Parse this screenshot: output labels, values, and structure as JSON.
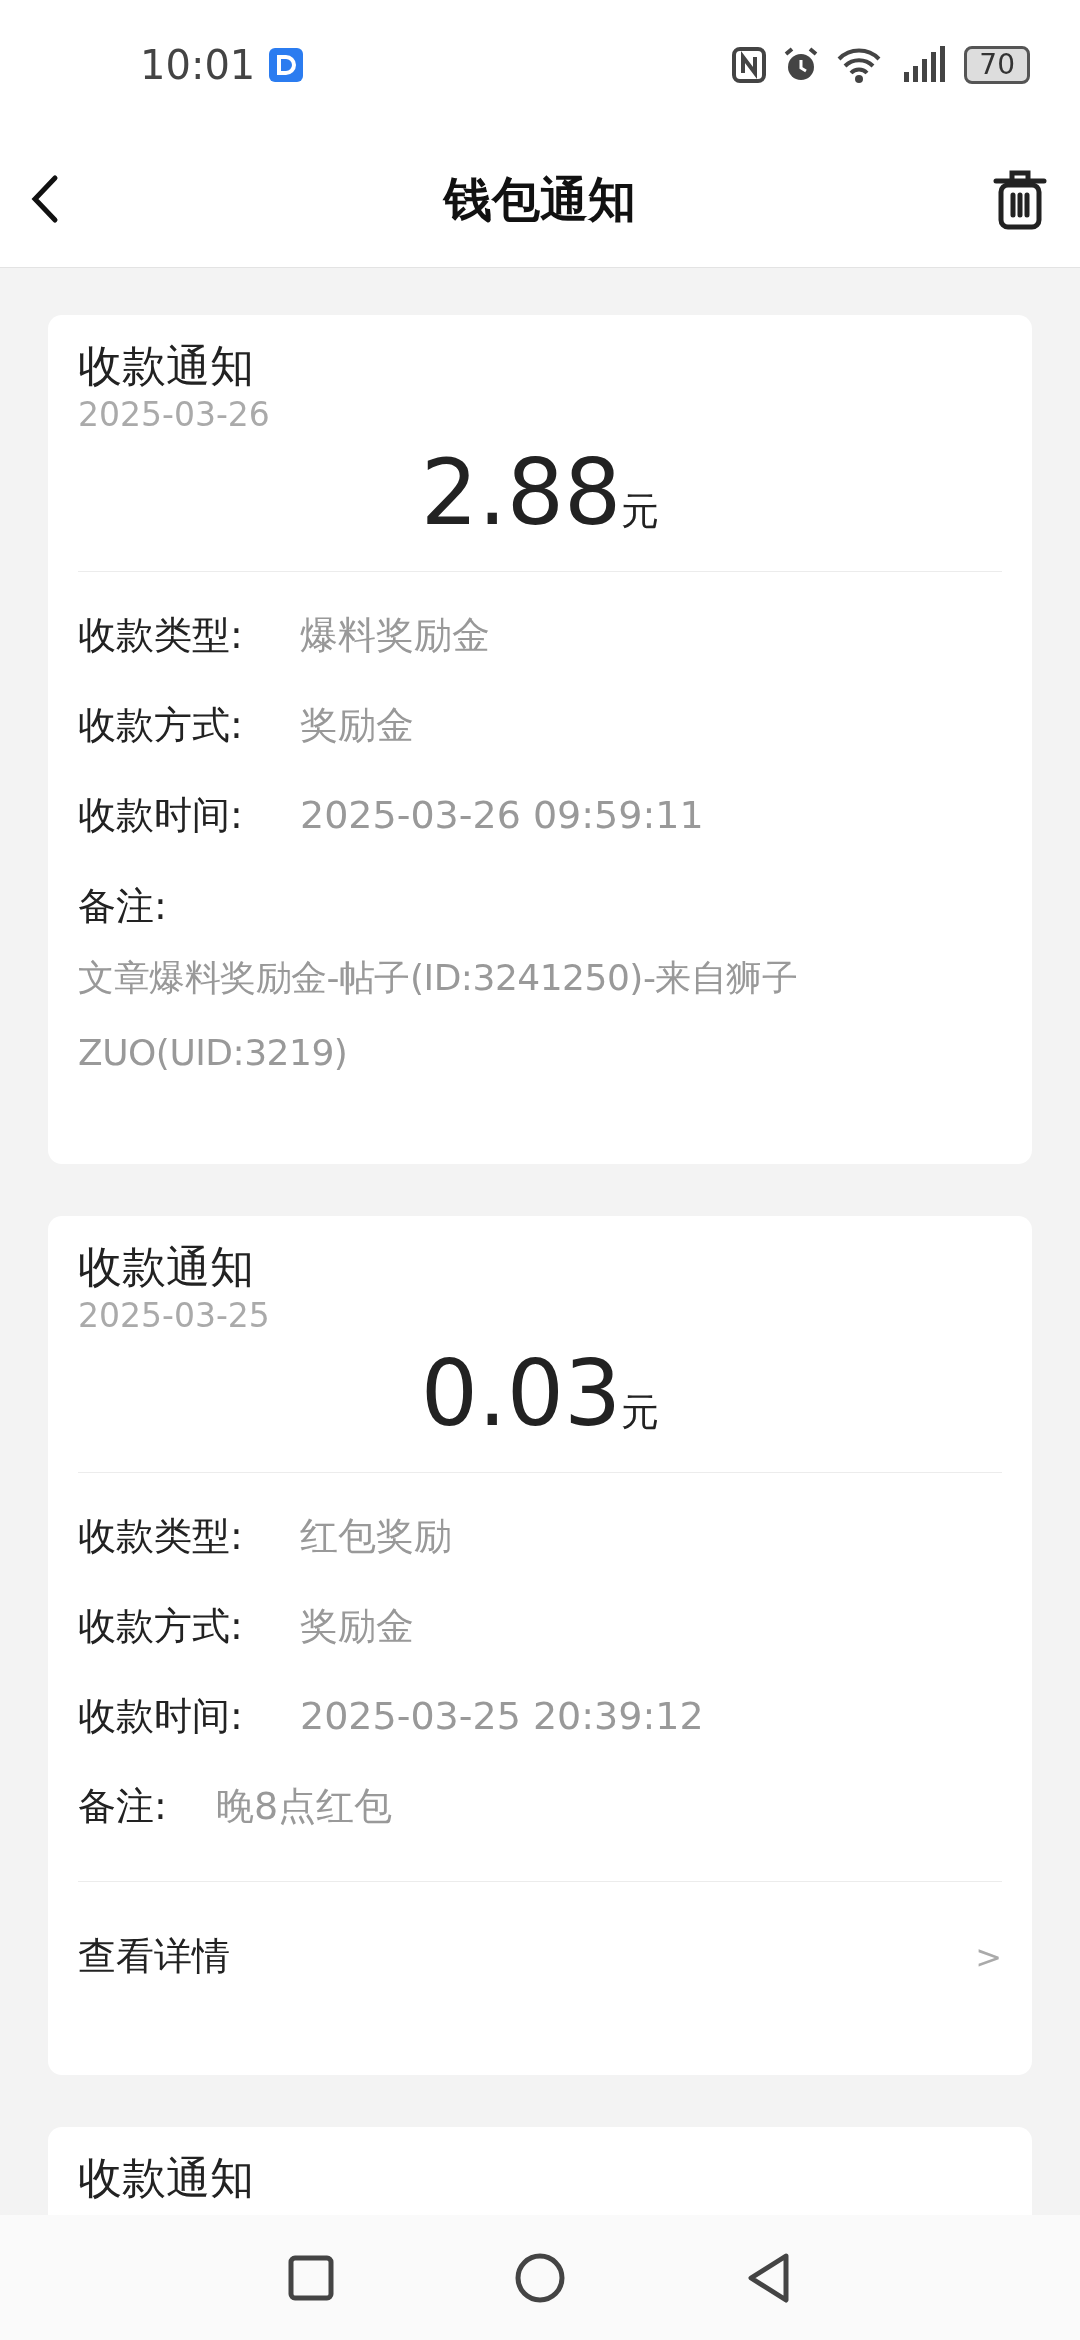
{
  "status_bar": {
    "time": "10:01",
    "battery": "70"
  },
  "header": {
    "title": "钱包通知"
  },
  "cards": [
    {
      "title": "收款通知",
      "date": "2025-03-26",
      "amount": "2.88",
      "unit": "元",
      "rows": [
        {
          "kind": "field",
          "label": "收款类型:",
          "value": "爆料奖励金"
        },
        {
          "kind": "field",
          "label": "收款方式:",
          "value": "奖励金"
        },
        {
          "kind": "field",
          "label": "收款时间:",
          "value": "2025-03-26 09:59:11"
        },
        {
          "kind": "note_block",
          "label": "备注:",
          "value": "文章爆料奖励金-帖子(ID:3241250)-来自狮子ZUO(UID:3219)"
        }
      ]
    },
    {
      "title": "收款通知",
      "date": "2025-03-25",
      "amount": "0.03",
      "unit": "元",
      "rows": [
        {
          "kind": "field",
          "label": "收款类型:",
          "value": "红包奖励"
        },
        {
          "kind": "field",
          "label": "收款方式:",
          "value": "奖励金"
        },
        {
          "kind": "field",
          "label": "收款时间:",
          "value": "2025-03-25 20:39:12"
        },
        {
          "kind": "note_inline",
          "label": "备注:",
          "value": "晚8点红包"
        }
      ],
      "link": {
        "label": "查看详情",
        "chevron": ">"
      }
    },
    {
      "title": "收款通知"
    }
  ]
}
